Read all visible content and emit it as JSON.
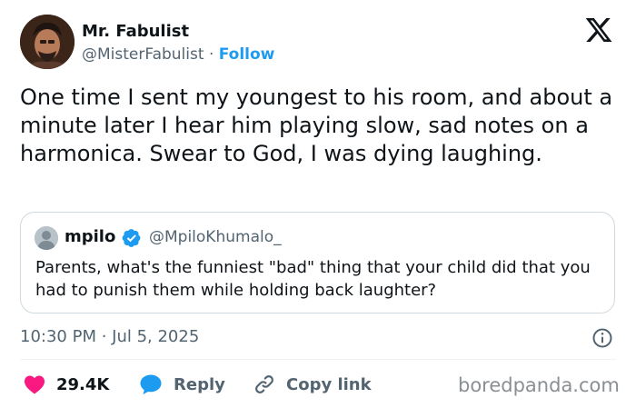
{
  "author": {
    "name": "Mr. Fabulist",
    "handle": "@MisterFabulist",
    "separator": "·",
    "follow_label": "Follow"
  },
  "tweet": {
    "text": "One time I sent my youngest to his room, and about a minute later I hear him playing slow, sad notes on a harmonica. Swear to God, I was dying laughing.",
    "timestamp": "10:30 PM · Jul 5, 2025"
  },
  "quoted_tweet": {
    "name": "mpilo",
    "handle": "@MpiloKhumalo_",
    "text": "Parents, what's the funniest \"bad\" thing that your child did that you had to punish them while holding back laughter?"
  },
  "actions": {
    "like_count": "29.4K",
    "reply_label": "Reply",
    "copy_link_label": "Copy link"
  },
  "watermark": "boredpanda.com",
  "colors": {
    "accent": "#1d9bf0",
    "like": "#f91880",
    "secondary_text": "#536471"
  }
}
